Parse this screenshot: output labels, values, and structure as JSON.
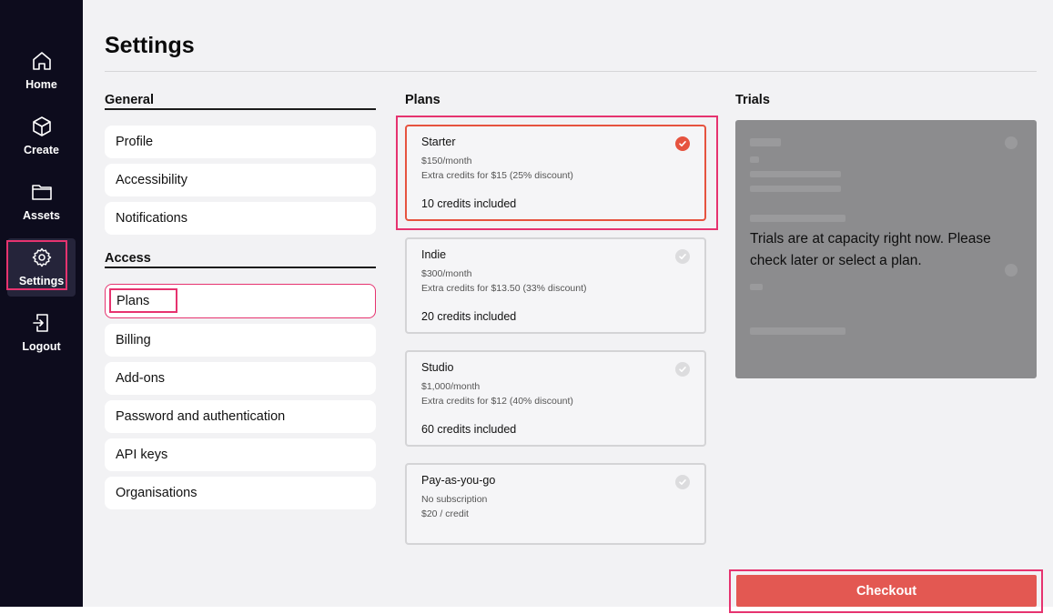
{
  "sidebar": {
    "items": [
      {
        "label": "Home",
        "icon": "home-icon"
      },
      {
        "label": "Create",
        "icon": "cube-icon"
      },
      {
        "label": "Assets",
        "icon": "folder-icon"
      },
      {
        "label": "Settings",
        "icon": "gear-icon"
      },
      {
        "label": "Logout",
        "icon": "logout-icon"
      }
    ],
    "active": "Settings"
  },
  "page": {
    "title": "Settings"
  },
  "general": {
    "heading": "General",
    "items": [
      "Profile",
      "Accessibility",
      "Notifications"
    ]
  },
  "access": {
    "heading": "Access",
    "items": [
      "Plans",
      "Billing",
      "Add-ons",
      "Password and authentication",
      "API keys",
      "Organisations"
    ],
    "selected": "Plans"
  },
  "plans": {
    "heading": "Plans",
    "items": [
      {
        "name": "Starter",
        "price": "$150/month",
        "extra": "Extra credits for $15 (25% discount)",
        "credits": "10 credits included",
        "selected": true
      },
      {
        "name": "Indie",
        "price": "$300/month",
        "extra": "Extra credits for $13.50 (33% discount)",
        "credits": "20 credits included",
        "selected": false
      },
      {
        "name": "Studio",
        "price": "$1,000/month",
        "extra": "Extra credits for $12 (40% discount)",
        "credits": "60 credits included",
        "selected": false
      },
      {
        "name": "Pay-as-you-go",
        "price": "No subscription",
        "extra": "$20 / credit",
        "credits": "",
        "selected": false
      }
    ]
  },
  "trials": {
    "heading": "Trials",
    "message": "Trials are at capacity right now. Please check later or select a plan."
  },
  "checkout": {
    "label": "Checkout"
  },
  "colors": {
    "sidebar_bg": "#0d0c1d",
    "accent": "#e35852",
    "highlight": "#e6336f",
    "main_bg": "#f2f2f4"
  }
}
